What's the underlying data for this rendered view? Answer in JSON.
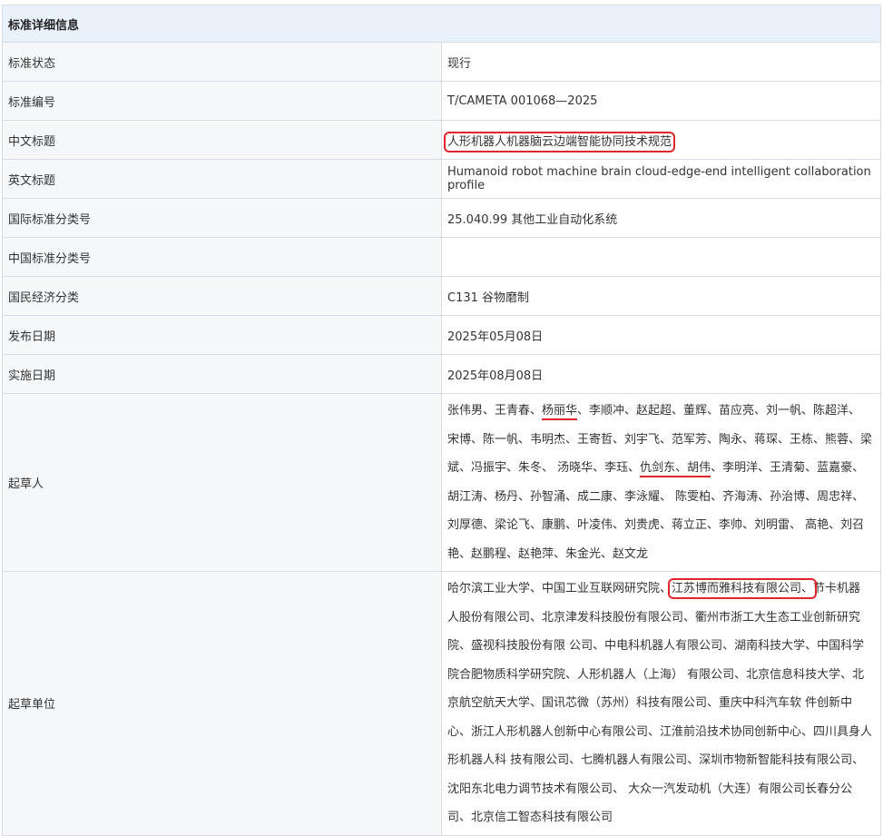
{
  "header": {
    "title": "标准详细信息"
  },
  "rows": [
    {
      "label": "标准状态",
      "value": "现行"
    },
    {
      "label": "标准编号",
      "value": "T/CAMETA 001068—2025"
    },
    {
      "label": "中文标题",
      "value": "人形机器人机器脑云边端智能协同技术规范"
    },
    {
      "label": "英文标题",
      "value": "Humanoid robot machine brain cloud-edge-end intelligent collaboration profile"
    },
    {
      "label": "国际标准分类号",
      "value": "25.040.99 其他工业自动化系统"
    },
    {
      "label": "中国标准分类号",
      "value": ""
    },
    {
      "label": "国民经济分类",
      "value": "C131 谷物磨制"
    },
    {
      "label": "发布日期",
      "value": "2025年05月08日"
    },
    {
      "label": "实施日期",
      "value": "2025年08月08日"
    }
  ],
  "drafters": {
    "label": "起草人",
    "text1": "张伟男、王青春、",
    "hl1": "杨丽华",
    "text2": "、李顺冲、赵起超、董辉、苗应亮、刘一帆、陈超洋、 宋博、陈一帆、韦明杰、王寄哲、刘宇飞、范军芳、陶永、蒋琛、王栋、熊蓉、梁斌、冯振宇、朱冬、 汤晓华、李珏、",
    "hl2": "仇剑东、胡伟",
    "text3": "、李明洋、王清菊、蓝嘉豪、胡江涛、杨丹、孙智涌、成二康、李泳耀、 陈雯柏、齐海涛、孙治博、周忠祥、刘厚德、梁论飞、康鹏、叶凌伟、刘贵虎、蒋立正、李帅、刘明雷、 高艳、刘召艳、赵鹏程、赵艳萍、朱金光、赵文龙"
  },
  "units": {
    "label": "起草单位",
    "text1": "哈尔滨工业大学、中国工业互联网研究院、",
    "hl1": "江苏博而雅科技有限公司、",
    "text2": "节卡机器 人股份有限公司、北京津发科技股份有限公司、衢州市浙工大生态工业创新研究院、盛视科技股份有限 公司、中电科机器人有限公司、湖南科技大学、中国科学院合肥物质科学研究院、人形机器人（上海） 有限公司、北京信息科技大学、北京航空航天大学、国讯芯微（苏州）科技有限公司、重庆中科汽车软 件创新中心、浙江人形机器人创新中心有限公司、江淮前沿技术协同创新中心、四川具身人形机器人科 技有限公司、七腾机器人有限公司、深圳市物新智能科技有限公司、沈阳东北电力调节技术有限公司、 大众一汽发动机（大连）有限公司长春分公司、北京信工智态科技有限公司"
  }
}
